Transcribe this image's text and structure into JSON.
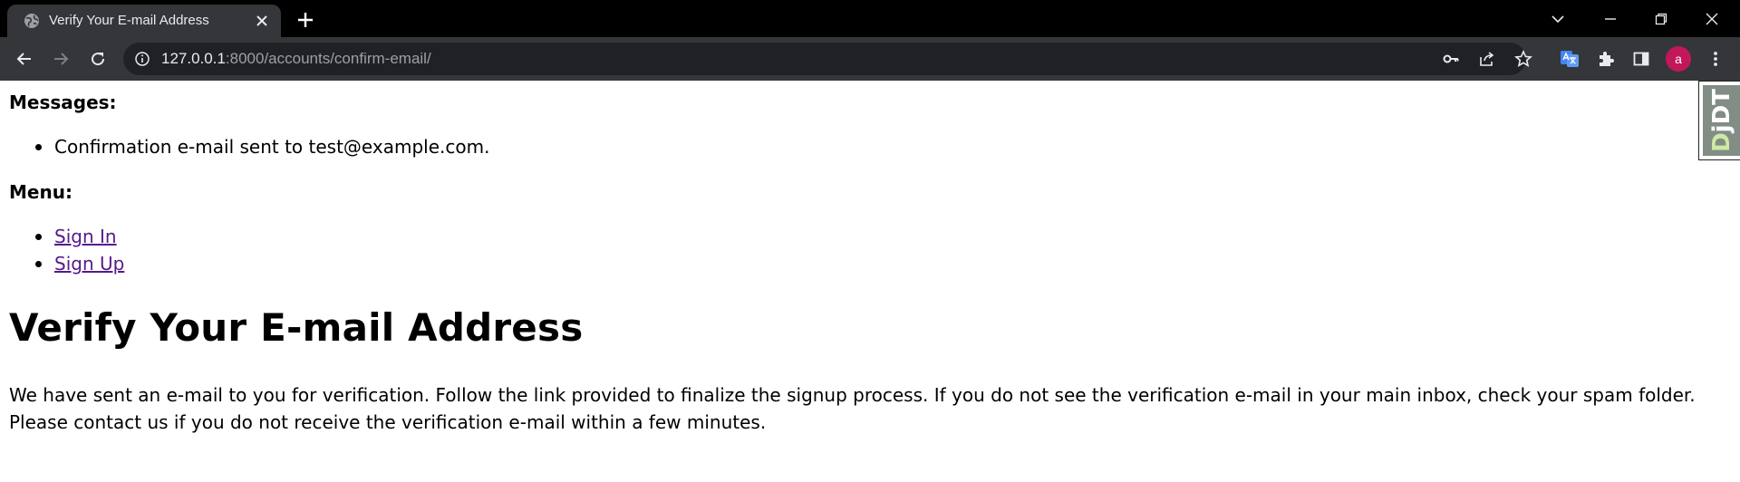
{
  "browser": {
    "tab_title": "Verify Your E-mail Address",
    "url_host": "127.0.0.1",
    "url_rest": ":8000/accounts/confirm-email/",
    "profile_initial": "a"
  },
  "page": {
    "messages_heading": "Messages:",
    "messages": [
      "Confirmation e-mail sent to test@example.com."
    ],
    "menu_heading": "Menu:",
    "menu_items": [
      "Sign In",
      "Sign Up"
    ],
    "title": "Verify Your E-mail Address",
    "body": "We have sent an e-mail to you for verification. Follow the link provided to finalize the signup process. If you do not see the verification e-mail in your main inbox, check your spam folder. Please contact us if you do not receive the verification e-mail within a few minutes."
  },
  "debug_toolbar": {
    "label_d": "D",
    "label_rest": "jDT"
  },
  "colors": {
    "link": "#551a8b",
    "avatar": "#c2185b",
    "chrome_bg": "#35363a"
  }
}
